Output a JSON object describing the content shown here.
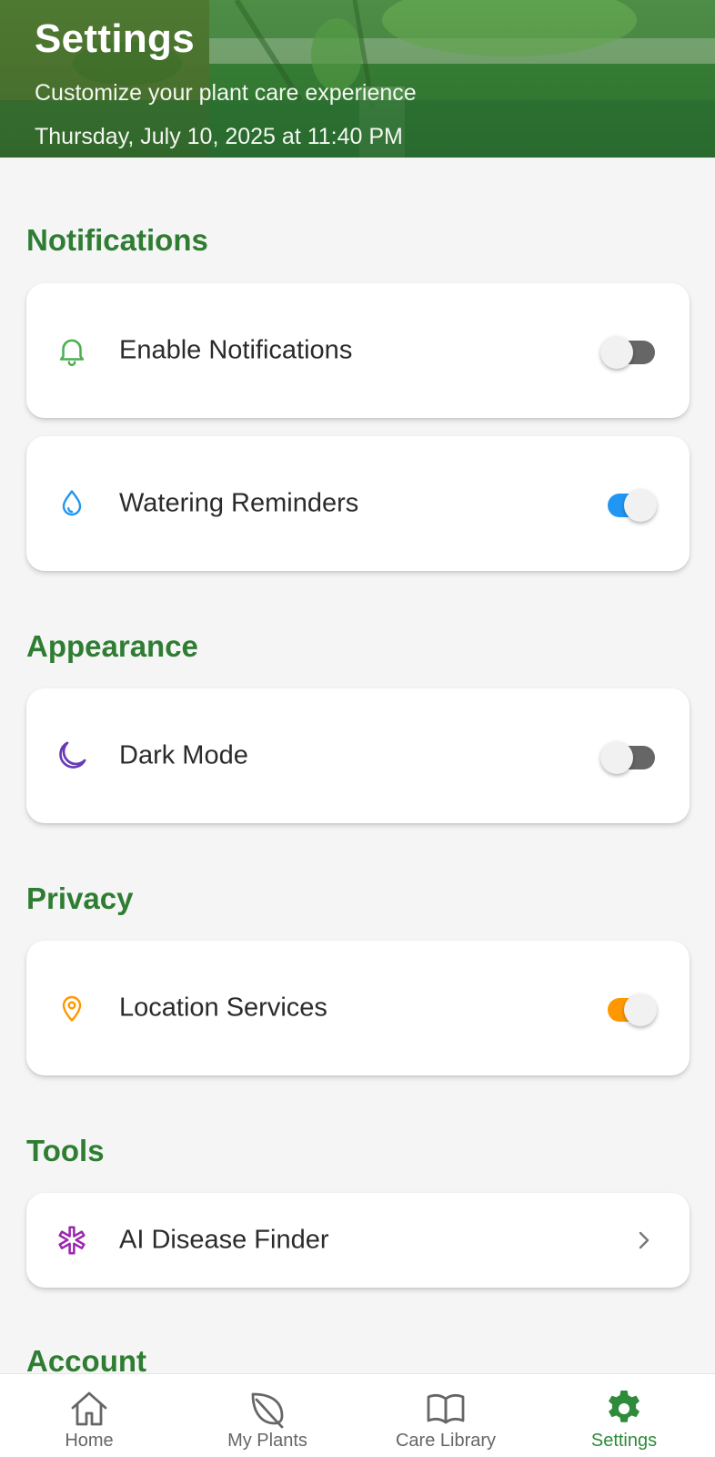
{
  "header": {
    "title": "Settings",
    "subtitle": "Customize your plant care experience",
    "datetime": "Thursday, July 10, 2025 at 11:40 PM"
  },
  "sections": {
    "notifications": {
      "title": "Notifications",
      "items": [
        {
          "label": "Enable Notifications",
          "icon": "bell-icon",
          "type": "toggle",
          "on": false
        },
        {
          "label": "Watering Reminders",
          "icon": "water-drop-icon",
          "type": "toggle",
          "on": true,
          "color": "#2196f3"
        }
      ]
    },
    "appearance": {
      "title": "Appearance",
      "items": [
        {
          "label": "Dark Mode",
          "icon": "moon-icon",
          "type": "toggle",
          "on": false
        }
      ]
    },
    "privacy": {
      "title": "Privacy",
      "items": [
        {
          "label": "Location Services",
          "icon": "map-pin-icon",
          "type": "toggle",
          "on": true,
          "color": "#ff9800"
        }
      ]
    },
    "tools": {
      "title": "Tools",
      "items": [
        {
          "label": "AI Disease Finder",
          "icon": "asterisk-icon",
          "type": "link"
        }
      ]
    },
    "account": {
      "title": "Account"
    }
  },
  "tabbar": {
    "items": [
      {
        "label": "Home",
        "icon": "home-icon",
        "active": false
      },
      {
        "label": "My Plants",
        "icon": "leaf-icon",
        "active": false
      },
      {
        "label": "Care Library",
        "icon": "book-icon",
        "active": false
      },
      {
        "label": "Settings",
        "icon": "gear-icon",
        "active": true
      }
    ]
  },
  "colors": {
    "brand_green": "#2e7d32",
    "active_tab": "#2e8b3a",
    "toggle_off": "#666666",
    "toggle_blue": "#2196f3",
    "toggle_orange": "#ff9800",
    "bell_icon": "#4caf50",
    "drop_icon": "#2196f3",
    "moon_icon": "#673ab7",
    "pin_icon": "#ff9800",
    "asterisk_icon": "#9c27b0"
  }
}
